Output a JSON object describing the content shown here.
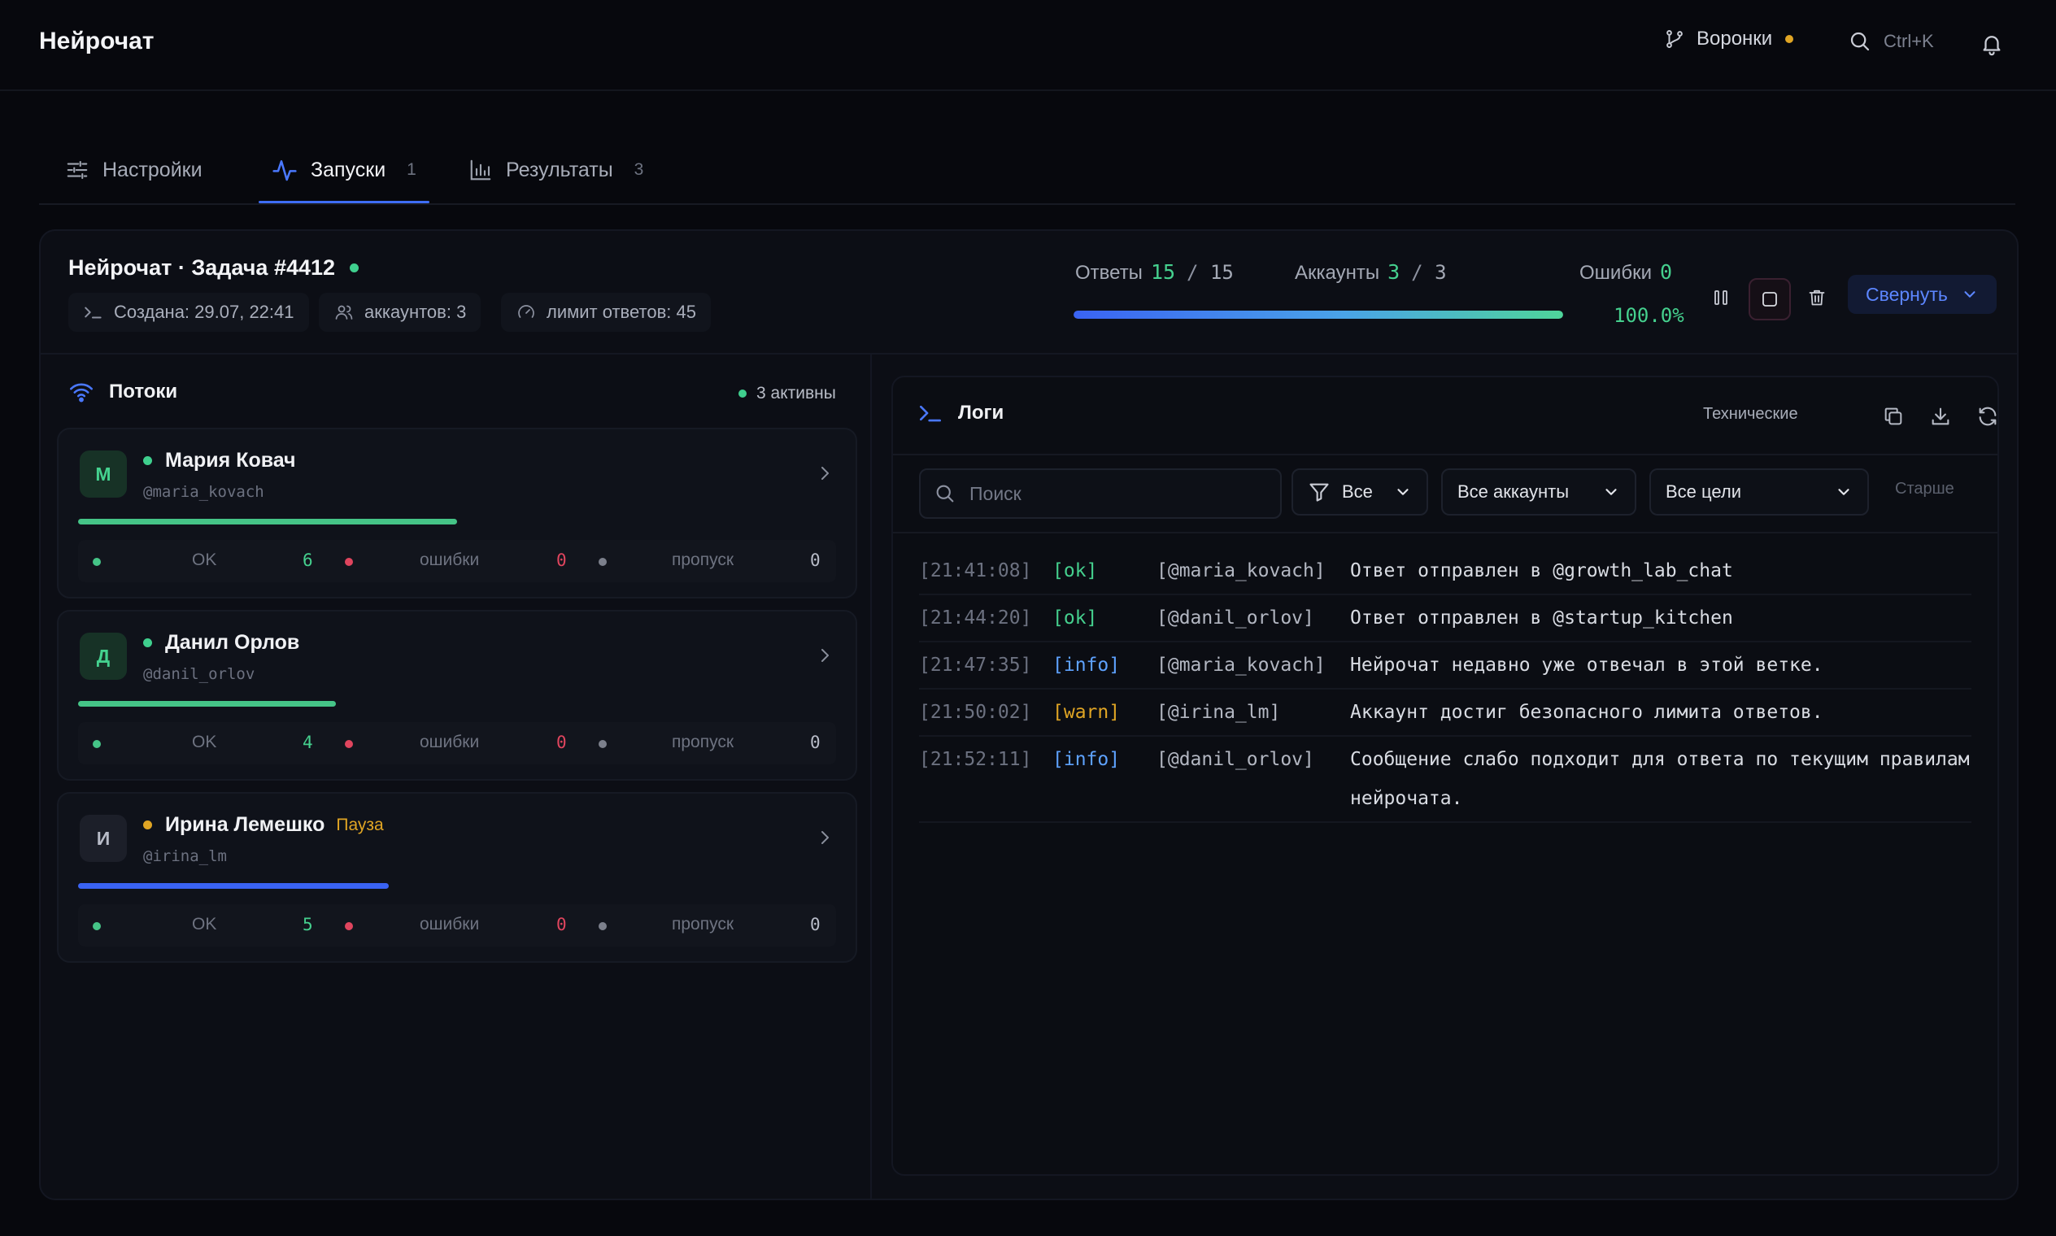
{
  "app": {
    "title": "Нейрочат"
  },
  "topbar": {
    "funnels_label": "Воронки",
    "search_shortcut": "Ctrl+K"
  },
  "tabs": [
    {
      "label": "Настройки",
      "count": ""
    },
    {
      "label": "Запуски",
      "count": "1"
    },
    {
      "label": "Результаты",
      "count": "3"
    }
  ],
  "task": {
    "title": "Нейрочат · Задача #4412",
    "created": "Создана: 29.07, 22:41",
    "accounts": "аккаунтов: 3",
    "reply_limit": "лимит ответов: 45"
  },
  "stats": {
    "answers_label": "Ответы",
    "answers_done": "15",
    "answers_total": "15",
    "accounts_label": "Аккаунты",
    "accounts_done": "3",
    "accounts_total": "3",
    "errors_label": "Ошибки",
    "errors_count": "0",
    "progress_fraction": 1.0,
    "progress_text": "100.0%"
  },
  "actions": {
    "collapse_label": "Свернуть"
  },
  "streams": {
    "title": "Потоки",
    "active_label": "3 активны",
    "items": [
      {
        "initial": "М",
        "name": "Мария Ковач",
        "handle": "@maria_kovach",
        "status": "",
        "ok_label": "OK",
        "ok": "6",
        "err_label": "ошибки",
        "err": "0",
        "skip_label": "пропуск",
        "skip": "0",
        "progress_fraction": 0.5,
        "color": "#45c487"
      },
      {
        "initial": "Д",
        "name": "Данил Орлов",
        "handle": "@danil_orlov",
        "status": "",
        "ok_label": "OK",
        "ok": "4",
        "err_label": "ошибки",
        "err": "0",
        "skip_label": "пропуск",
        "skip": "0",
        "progress_fraction": 0.34,
        "color": "#45c487"
      },
      {
        "initial": "И",
        "name": "Ирина Лемешко",
        "handle": "@irina_lm",
        "status": "Пауза",
        "ok_label": "OK",
        "ok": "5",
        "err_label": "ошибки",
        "err": "0",
        "skip_label": "пропуск",
        "skip": "0",
        "progress_fraction": 0.41,
        "color": "#3a63f3"
      }
    ]
  },
  "logs": {
    "title": "Логи",
    "tech_label": "Технические",
    "search_placeholder": "Поиск",
    "filter_level": "Все",
    "filter_accounts": "Все аккаунты",
    "filter_targets": "Все цели",
    "older_label": "Старше",
    "rows": [
      {
        "time": "[21:41:08]",
        "level": "[ok]",
        "account": "[@maria_kovach]",
        "message": "Ответ отправлен в @growth_lab_chat"
      },
      {
        "time": "[21:44:20]",
        "level": "[ok]",
        "account": "[@danil_orlov]",
        "message": "Ответ отправлен в @startup_kitchen"
      },
      {
        "time": "[21:47:35]",
        "level": "[info]",
        "account": "[@maria_kovach]",
        "message": "Нейрочат недавно уже отвечал в этой ветке."
      },
      {
        "time": "[21:50:02]",
        "level": "[warn]",
        "account": "[@irina_lm]",
        "message": "Аккаунт достиг безопасного лимита ответов."
      },
      {
        "time": "[21:52:11]",
        "level": "[info]",
        "account": "[@danil_orlov]",
        "message": "Сообщение слабо подходит для ответа по текущим правилам нейрочата."
      }
    ]
  },
  "colors": {
    "accent": "#3e6df5",
    "success": "#45d08e",
    "warning": "#e0a524",
    "error": "#e0455e"
  }
}
